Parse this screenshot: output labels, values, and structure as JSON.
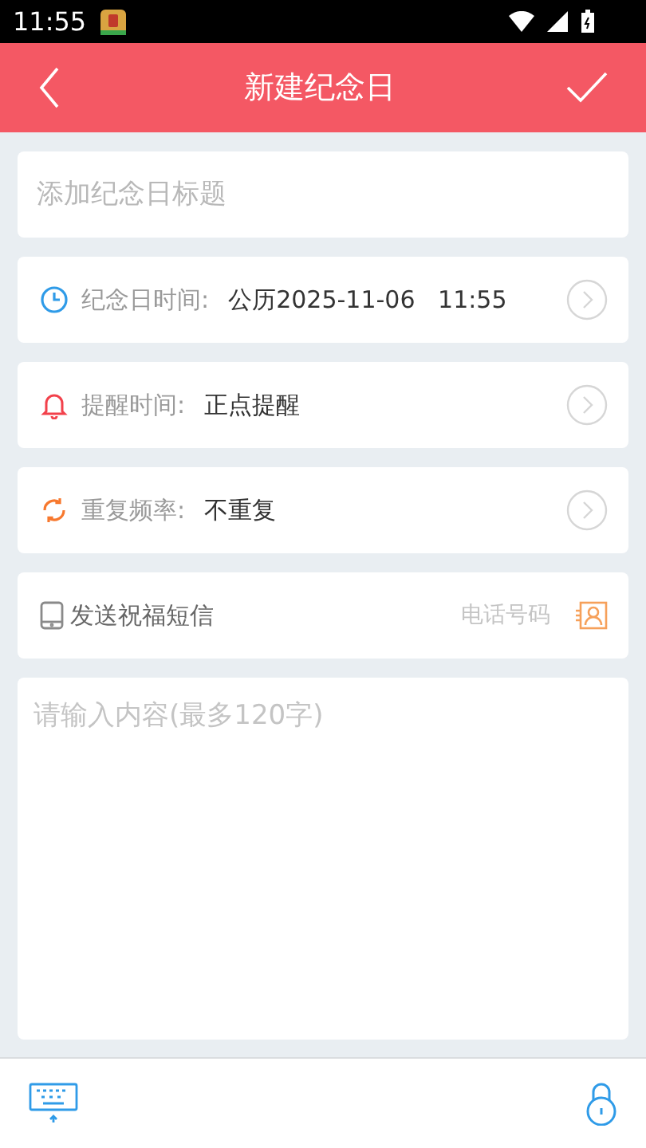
{
  "status_bar": {
    "time": "11:55"
  },
  "header": {
    "title": "新建纪念日"
  },
  "title_field": {
    "placeholder": "添加纪念日标题"
  },
  "settings": [
    {
      "kind": "clock",
      "label": "纪念日时间:",
      "value": "公历2025-11-06   11:55"
    },
    {
      "kind": "bell",
      "label": "提醒时间:",
      "value": "正点提醒"
    },
    {
      "kind": "repeat",
      "label": "重复频率:",
      "value": "不重复"
    }
  ],
  "sms": {
    "label": "发送祝福短信",
    "phone_placeholder": "电话号码"
  },
  "content": {
    "placeholder": "请输入内容(最多120字)"
  }
}
